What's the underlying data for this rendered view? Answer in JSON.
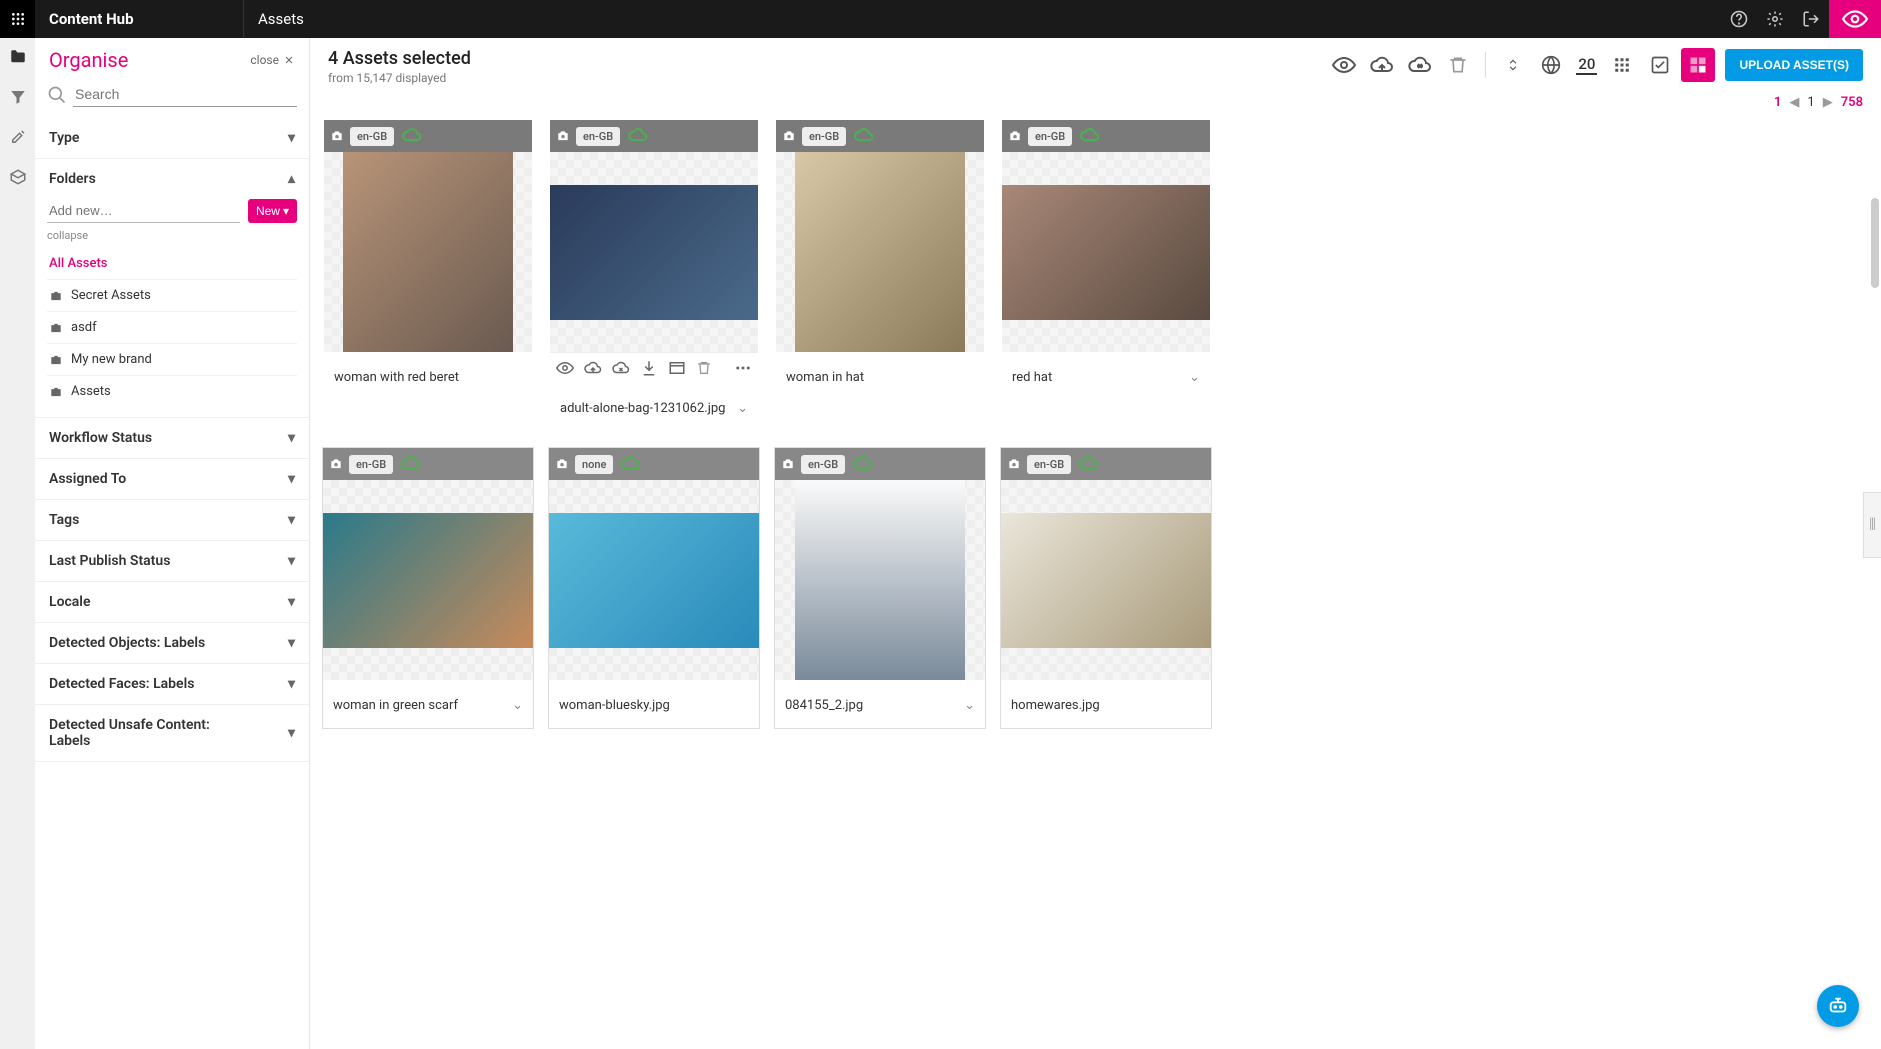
{
  "app": {
    "brand": "Content Hub",
    "section": "Assets"
  },
  "header": {
    "selected_line": "4 Assets selected",
    "displayed_line": "from 15,147 displayed",
    "page_size": "20",
    "upload_label": "UPLOAD ASSET(S)"
  },
  "pager": {
    "page": "1",
    "current": "1",
    "total": "758"
  },
  "sidebar": {
    "title": "Organise",
    "close_label": "close",
    "search_placeholder": "Search",
    "add_folder_placeholder": "Add new…",
    "new_label": "New",
    "collapse_label": "collapse",
    "sections": {
      "type": "Type",
      "folders": "Folders",
      "workflow": "Workflow Status",
      "assigned": "Assigned To",
      "tags": "Tags",
      "publish": "Last Publish Status",
      "locale": "Locale",
      "objects": "Detected Objects: Labels",
      "faces": "Detected Faces: Labels",
      "unsafe": "Detected Unsafe Content: Labels"
    },
    "folders": [
      {
        "label": "All Assets",
        "active": true
      },
      {
        "label": "Secret Assets"
      },
      {
        "label": "asdf"
      },
      {
        "label": "My new brand"
      },
      {
        "label": "Assets"
      }
    ]
  },
  "assets": [
    {
      "locale": "en-GB",
      "name": "woman with red beret",
      "selected": true,
      "tall": true,
      "ph": "ph1",
      "chev": false
    },
    {
      "locale": "en-GB",
      "name": "adult-alone-bag-1231062.jpg",
      "selected": true,
      "hover": true,
      "ph": "ph2",
      "chev": true
    },
    {
      "locale": "en-GB",
      "name": "woman in hat",
      "selected": true,
      "tall": true,
      "ph": "ph3",
      "chev": false
    },
    {
      "locale": "en-GB",
      "name": "red hat",
      "selected": true,
      "ph": "ph4",
      "chev": true
    },
    {
      "locale": "en-GB",
      "name": "woman in green scarf",
      "ph": "ph5",
      "chev": true
    },
    {
      "locale": "none",
      "name": "woman-bluesky.jpg",
      "ph": "ph6",
      "chev": false
    },
    {
      "locale": "en-GB",
      "name": "084155_2.jpg",
      "tall": true,
      "ph": "ph7",
      "chev": true
    },
    {
      "locale": "en-GB",
      "name": "homewares.jpg",
      "ph": "ph8",
      "chev": false
    }
  ]
}
